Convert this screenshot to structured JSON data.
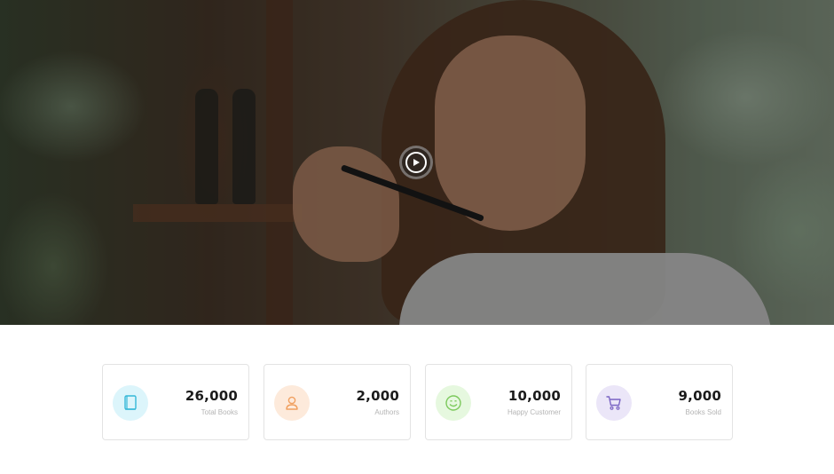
{
  "hero": {
    "play_button_icon": "play-icon"
  },
  "stats": [
    {
      "value": "26,000",
      "label": "Total Books",
      "icon": "book-icon",
      "icon_bg": "#dcf5fb",
      "icon_color": "#35b8d8"
    },
    {
      "value": "2,000",
      "label": "Authors",
      "icon": "user-icon",
      "icon_bg": "#fdeadb",
      "icon_color": "#f0a060"
    },
    {
      "value": "10,000",
      "label": "Happy Customer",
      "icon": "smile-icon",
      "icon_bg": "#e6f8df",
      "icon_color": "#7cc95c"
    },
    {
      "value": "9,000",
      "label": "Books Sold",
      "icon": "cart-icon",
      "icon_bg": "#ebe6f8",
      "icon_color": "#7a64c4"
    }
  ]
}
